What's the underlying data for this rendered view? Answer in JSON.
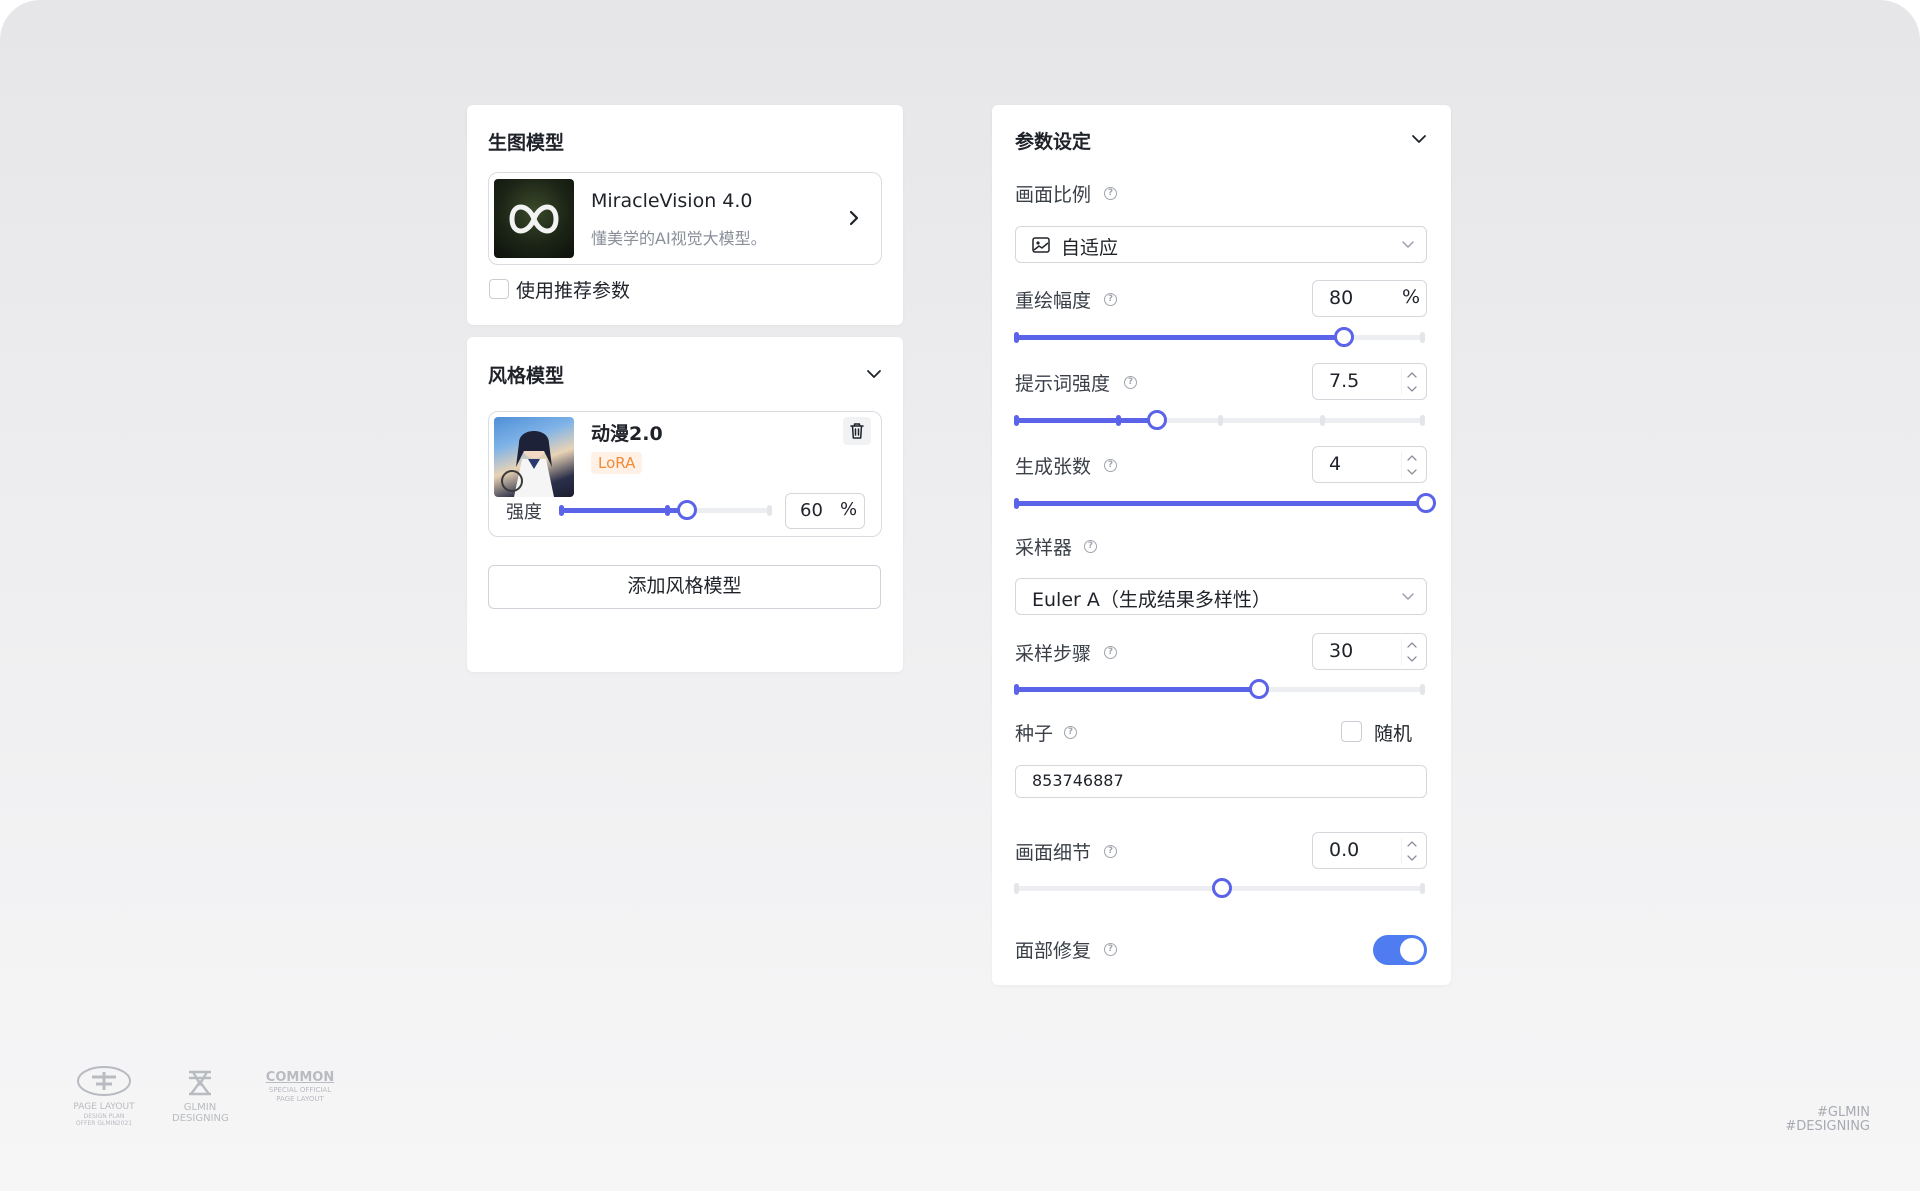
{
  "gen_model": {
    "title": "生图模型",
    "model_name": "MiracleVision 4.0",
    "model_desc": "懂美学的AI视觉大模型。",
    "use_recommended": "使用推荐参数"
  },
  "style_model": {
    "title": "风格模型",
    "item": {
      "name": "动漫2.0",
      "badge": "LoRA",
      "strength_label": "强度",
      "strength_value": "60",
      "strength_unit": "%",
      "strength_fraction": 0.6
    },
    "add_button": "添加风格模型"
  },
  "params": {
    "title": "参数设定",
    "aspect": {
      "label": "画面比例",
      "value": "自适应"
    },
    "redraw": {
      "label": "重绘幅度",
      "value": "80",
      "unit": "%",
      "fraction": 0.8
    },
    "prompt_strength": {
      "label": "提示词强度",
      "value": "7.5",
      "fraction": 0.34
    },
    "count": {
      "label": "生成张数",
      "value": "4",
      "fraction": 1.0
    },
    "sampler": {
      "label": "采样器",
      "value": "Euler A（生成结果多样性）"
    },
    "steps": {
      "label": "采样步骤",
      "value": "30",
      "fraction": 0.59
    },
    "seed": {
      "label": "种子",
      "random_label": "随机",
      "value": "853746887"
    },
    "detail": {
      "label": "画面细节",
      "value": "0.0",
      "fraction": 0.5
    },
    "face_fix": {
      "label": "面部修复",
      "enabled": true
    }
  },
  "footer": {
    "logo1_lines": [
      "PAGE LAYOUT",
      "DESIGN PLAN",
      "OFFER GLMIN2021"
    ],
    "logo2_lines": [
      "GLMIN",
      "DESIGNING"
    ],
    "logo3_title": "COMMON",
    "logo3_lines": [
      "SPECIAL OFFICIAL",
      "PAGE LAYOUT"
    ],
    "tag_lines": [
      "#GLMIN",
      "#DESIGNING"
    ]
  },
  "colors": {
    "accent": "#5b63e8",
    "toggle": "#4f7cf0",
    "badge_bg": "#fff1e6",
    "badge_text": "#f08b3a"
  }
}
